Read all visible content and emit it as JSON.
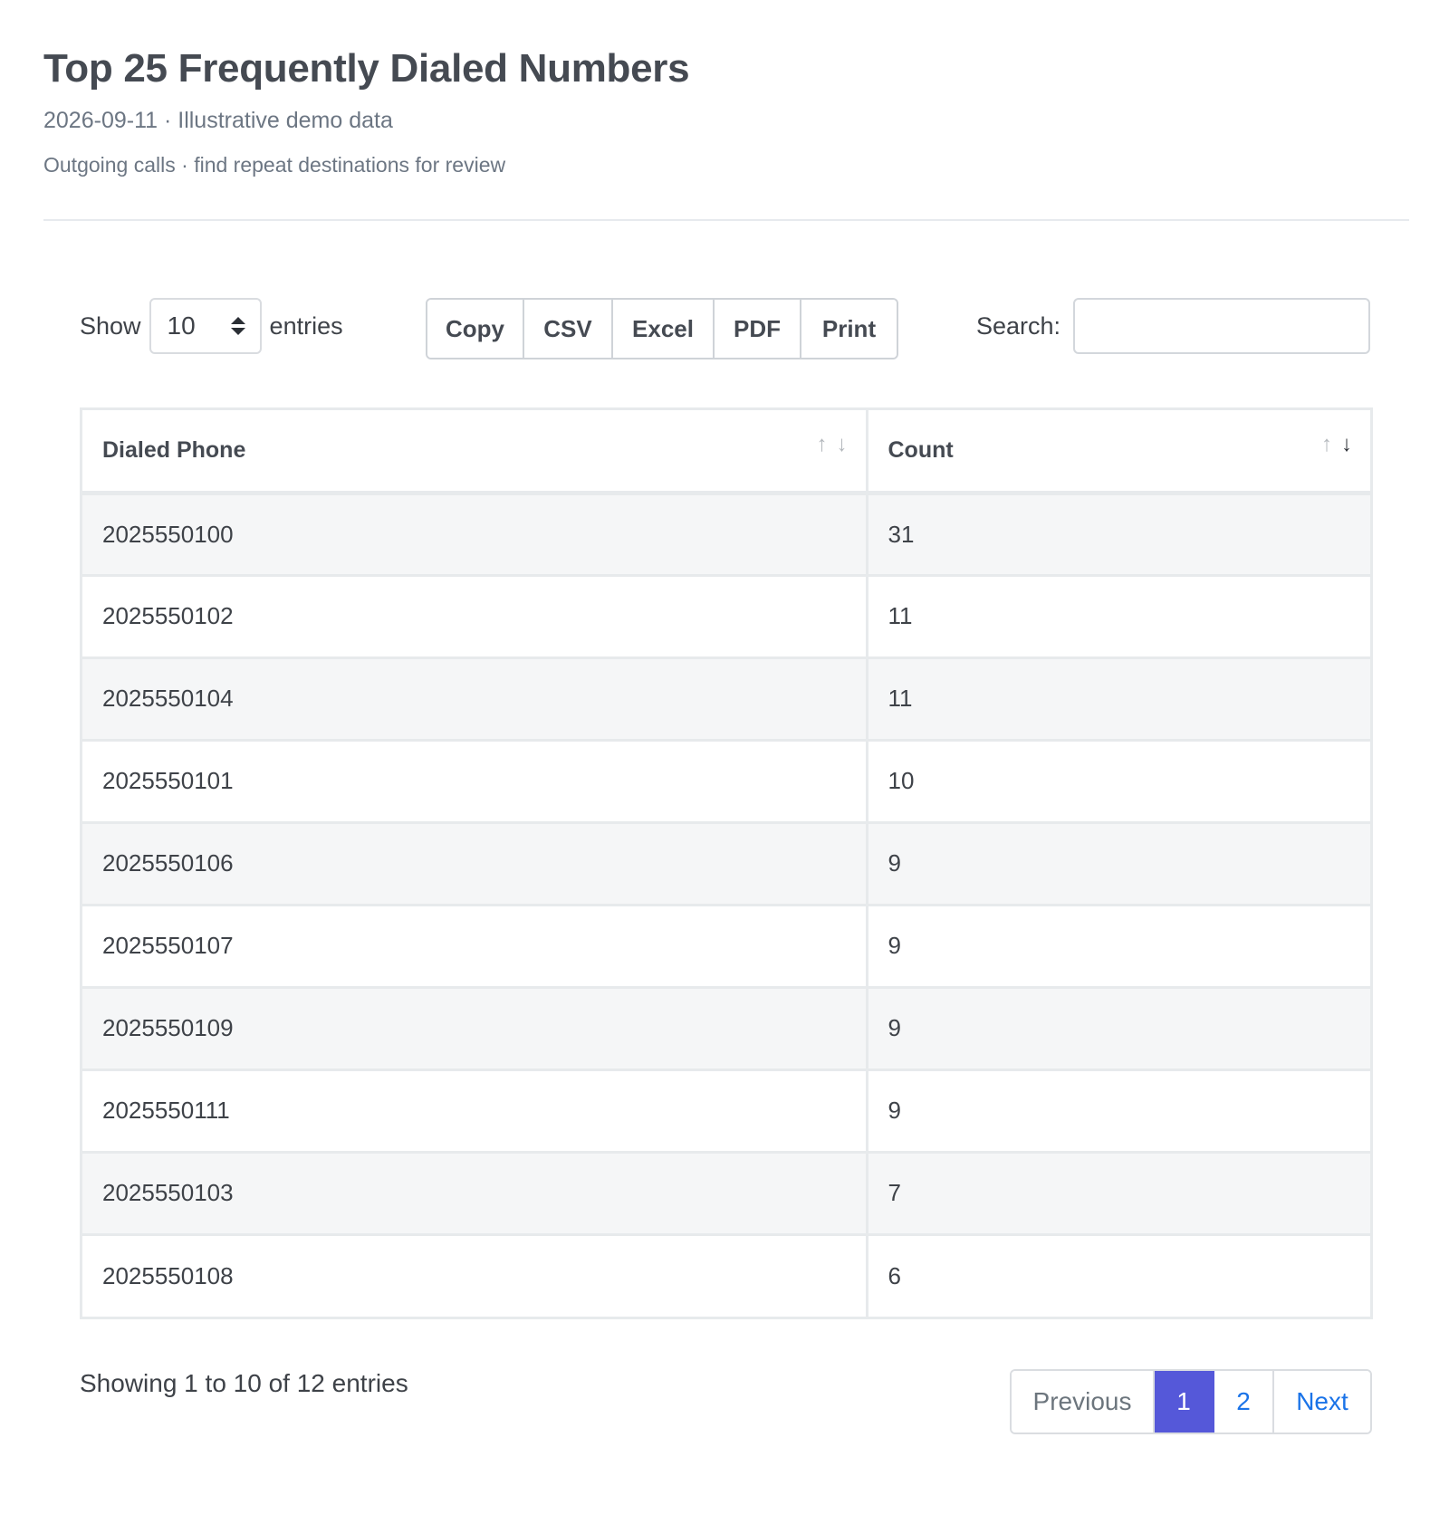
{
  "header": {
    "title": "Top 25 Frequently Dialed Numbers",
    "subtitle": "2026-09-11 · Illustrative demo data",
    "description": "Outgoing calls · find repeat destinations for review"
  },
  "controls": {
    "show_label": "Show",
    "entries_label": "entries",
    "page_length": "10",
    "buttons": {
      "copy": "Copy",
      "csv": "CSV",
      "excel": "Excel",
      "pdf": "PDF",
      "print": "Print"
    },
    "search_label": "Search:",
    "search_value": ""
  },
  "table": {
    "columns": [
      "Dialed Phone",
      "Count"
    ],
    "sort": {
      "column": "Count",
      "direction": "descending"
    },
    "rows": [
      [
        "2025550100",
        "31"
      ],
      [
        "2025550102",
        "11"
      ],
      [
        "2025550104",
        "11"
      ],
      [
        "2025550101",
        "10"
      ],
      [
        "2025550106",
        "9"
      ],
      [
        "2025550107",
        "9"
      ],
      [
        "2025550109",
        "9"
      ],
      [
        "2025550111",
        "9"
      ],
      [
        "2025550103",
        "7"
      ],
      [
        "2025550108",
        "6"
      ]
    ]
  },
  "footer": {
    "info": "Showing 1 to 10 of 12 entries",
    "pagination": {
      "previous": "Previous",
      "pages": [
        "1",
        "2"
      ],
      "current_page": "1",
      "next": "Next"
    }
  },
  "colors": {
    "active_page": "#5558d9",
    "link": "#1a73e8",
    "striped_row": "#f5f6f7"
  },
  "icons": {
    "select_arrows": "sort-updown-icon",
    "sort_asc": "arrow-up-icon",
    "sort_desc": "arrow-down-icon"
  }
}
